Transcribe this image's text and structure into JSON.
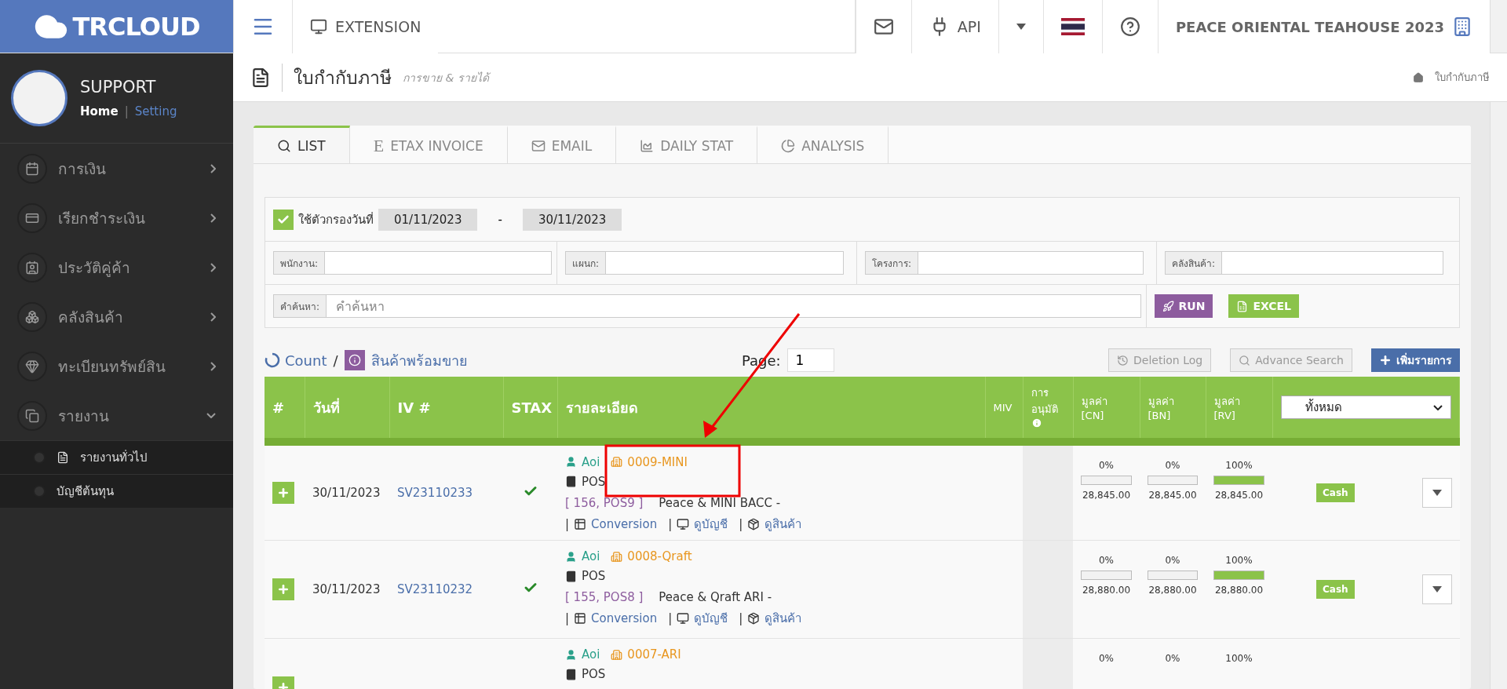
{
  "header": {
    "brand": "TRCLOUD",
    "nav": [
      {
        "label": "EXTENSION"
      }
    ],
    "api": "API",
    "company": "PEACE ORIENTAL TEAHOUSE 2023"
  },
  "sidebar": {
    "user": "SUPPORT",
    "links_separator": "|",
    "links": [
      {
        "label": "Home",
        "selected": true
      },
      {
        "label": "Setting",
        "selected": false
      }
    ],
    "items": [
      {
        "label": "การเงิน",
        "expanded": false
      },
      {
        "label": "เรียกชำระเงิน",
        "expanded": false
      },
      {
        "label": "ประวัติคู่ค้า",
        "expanded": false
      },
      {
        "label": "คลังสินค้า",
        "expanded": false
      },
      {
        "label": "ทะเบียนทรัพย์สิน",
        "expanded": false
      },
      {
        "label": "รายงาน",
        "expanded": true,
        "children": [
          {
            "label": "รายงานทั่วไป",
            "kind": "file"
          },
          {
            "label": "บัญชีต้นทุน",
            "kind": "plain"
          }
        ]
      }
    ]
  },
  "page": {
    "title": "ใบกำกับภาษี",
    "subtitle": "การขาย & รายได้",
    "breadcrumb": "ใบกำกับภาษี"
  },
  "tabs": [
    {
      "label": "LIST",
      "selected": true
    },
    {
      "label": "ETAX INVOICE",
      "glyph": "E",
      "selected": false
    },
    {
      "label": "EMAIL",
      "selected": false
    },
    {
      "label": "DAILY STAT",
      "selected": false
    },
    {
      "label": "ANALYSIS",
      "selected": false
    }
  ],
  "filter": {
    "checked": true,
    "label": "ใช้ตัวกรองวันที่",
    "from": "01/11/2023",
    "separator": "-",
    "to": "30/11/2023",
    "fields": [
      {
        "label": "พนักงาน:"
      },
      {
        "label": "แผนก:"
      },
      {
        "label": "โครงการ:"
      },
      {
        "label": "คลังสินค้า:"
      }
    ],
    "search": {
      "label": "คำค้นหา:",
      "placeholder": "คำค้นหา"
    },
    "run": "RUN",
    "excel": "EXCEL"
  },
  "toolbar": {
    "count": "Count",
    "slash": "/",
    "stock": "สินค้าพร้อมขาย",
    "page_label": "Page:",
    "page": "1",
    "deletion_log": "Deletion Log",
    "advance_search": "Advance Search",
    "add": "เพิ่มรายการ"
  },
  "table": {
    "columns": [
      {
        "label": "#"
      },
      {
        "label": "วันที่"
      },
      {
        "label": "IV #"
      },
      {
        "label": "STAX"
      },
      {
        "label": "รายละเอียด"
      },
      {
        "label": "MIV"
      },
      {
        "label": "การ อนุมัติ",
        "info": true
      },
      {
        "label": "มูลค่า [CN]"
      },
      {
        "label": "มูลค่า [BN]"
      },
      {
        "label": "มูลค่า [RV]"
      }
    ],
    "status_select": "ทั้งหมด",
    "rows": [
      {
        "date": "30/11/2023",
        "iv": "SV23110233",
        "stax": true,
        "person": "Aoi",
        "branch": "0009-MINI",
        "channel": "POS",
        "ref": "[ 156, POS9 ]",
        "desc": "Peace & MINI BACC -",
        "links": [
          {
            "sep": "|",
            "label": "Conversion"
          },
          {
            "sep": "|",
            "label": "ดูบัญชี"
          },
          {
            "sep": "|",
            "label": "ดูสินค้า"
          }
        ],
        "values": [
          {
            "pct": "0%",
            "level": 0,
            "amount": "28,845.00"
          },
          {
            "pct": "0%",
            "level": 0,
            "amount": "28,845.00"
          },
          {
            "pct": "100%",
            "level": 1,
            "amount": "28,845.00"
          }
        ],
        "payment": "Cash"
      },
      {
        "date": "30/11/2023",
        "iv": "SV23110232",
        "stax": true,
        "person": "Aoi",
        "branch": "0008-Qraft",
        "channel": "POS",
        "ref": "[ 155, POS8 ]",
        "desc": "Peace & Qraft ARI -",
        "links": [
          {
            "sep": "|",
            "label": "Conversion"
          },
          {
            "sep": "|",
            "label": "ดูบัญชี"
          },
          {
            "sep": "|",
            "label": "ดูสินค้า"
          }
        ],
        "values": [
          {
            "pct": "0%",
            "level": 0,
            "amount": "28,880.00"
          },
          {
            "pct": "0%",
            "level": 0,
            "amount": "28,880.00"
          },
          {
            "pct": "100%",
            "level": 1,
            "amount": "28,880.00"
          }
        ],
        "payment": "Cash"
      },
      {
        "person": "Aoi",
        "branch": "0007-ARI",
        "channel": "POS",
        "values": [
          {
            "pct": "0%"
          },
          {
            "pct": "0%"
          },
          {
            "pct": "100%"
          }
        ]
      }
    ]
  }
}
